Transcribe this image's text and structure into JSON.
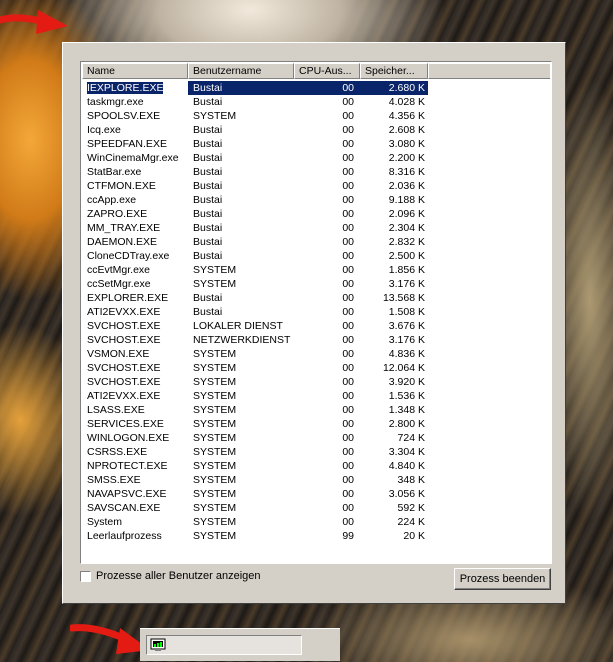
{
  "columns": {
    "name": "Name",
    "user": "Benutzername",
    "cpu": "CPU-Aus...",
    "mem": "Speicher..."
  },
  "processes": [
    {
      "name": "IEXPLORE.EXE",
      "user": "Bustai",
      "cpu": "00",
      "mem": "2.680 K"
    },
    {
      "name": "taskmgr.exe",
      "user": "Bustai",
      "cpu": "00",
      "mem": "4.028 K"
    },
    {
      "name": "SPOOLSV.EXE",
      "user": "SYSTEM",
      "cpu": "00",
      "mem": "4.356 K"
    },
    {
      "name": "Icq.exe",
      "user": "Bustai",
      "cpu": "00",
      "mem": "2.608 K"
    },
    {
      "name": "SPEEDFAN.EXE",
      "user": "Bustai",
      "cpu": "00",
      "mem": "3.080 K"
    },
    {
      "name": "WinCinemaMgr.exe",
      "user": "Bustai",
      "cpu": "00",
      "mem": "2.200 K"
    },
    {
      "name": "StatBar.exe",
      "user": "Bustai",
      "cpu": "00",
      "mem": "8.316 K"
    },
    {
      "name": "CTFMON.EXE",
      "user": "Bustai",
      "cpu": "00",
      "mem": "2.036 K"
    },
    {
      "name": "ccApp.exe",
      "user": "Bustai",
      "cpu": "00",
      "mem": "9.188 K"
    },
    {
      "name": "ZAPRO.EXE",
      "user": "Bustai",
      "cpu": "00",
      "mem": "2.096 K"
    },
    {
      "name": "MM_TRAY.EXE",
      "user": "Bustai",
      "cpu": "00",
      "mem": "2.304 K"
    },
    {
      "name": "DAEMON.EXE",
      "user": "Bustai",
      "cpu": "00",
      "mem": "2.832 K"
    },
    {
      "name": "CloneCDTray.exe",
      "user": "Bustai",
      "cpu": "00",
      "mem": "2.500 K"
    },
    {
      "name": "ccEvtMgr.exe",
      "user": "SYSTEM",
      "cpu": "00",
      "mem": "1.856 K"
    },
    {
      "name": "ccSetMgr.exe",
      "user": "SYSTEM",
      "cpu": "00",
      "mem": "3.176 K"
    },
    {
      "name": "EXPLORER.EXE",
      "user": "Bustai",
      "cpu": "00",
      "mem": "13.568 K"
    },
    {
      "name": "ATI2EVXX.EXE",
      "user": "Bustai",
      "cpu": "00",
      "mem": "1.508 K"
    },
    {
      "name": "SVCHOST.EXE",
      "user": "LOKALER DIENST",
      "cpu": "00",
      "mem": "3.676 K"
    },
    {
      "name": "SVCHOST.EXE",
      "user": "NETZWERKDIENST",
      "cpu": "00",
      "mem": "3.176 K"
    },
    {
      "name": "VSMON.EXE",
      "user": "SYSTEM",
      "cpu": "00",
      "mem": "4.836 K"
    },
    {
      "name": "SVCHOST.EXE",
      "user": "SYSTEM",
      "cpu": "00",
      "mem": "12.064 K"
    },
    {
      "name": "SVCHOST.EXE",
      "user": "SYSTEM",
      "cpu": "00",
      "mem": "3.920 K"
    },
    {
      "name": "ATI2EVXX.EXE",
      "user": "SYSTEM",
      "cpu": "00",
      "mem": "1.536 K"
    },
    {
      "name": "LSASS.EXE",
      "user": "SYSTEM",
      "cpu": "00",
      "mem": "1.348 K"
    },
    {
      "name": "SERVICES.EXE",
      "user": "SYSTEM",
      "cpu": "00",
      "mem": "2.800 K"
    },
    {
      "name": "WINLOGON.EXE",
      "user": "SYSTEM",
      "cpu": "00",
      "mem": "724 K"
    },
    {
      "name": "CSRSS.EXE",
      "user": "SYSTEM",
      "cpu": "00",
      "mem": "3.304 K"
    },
    {
      "name": "NPROTECT.EXE",
      "user": "SYSTEM",
      "cpu": "00",
      "mem": "4.840 K"
    },
    {
      "name": "SMSS.EXE",
      "user": "SYSTEM",
      "cpu": "00",
      "mem": "348 K"
    },
    {
      "name": "NAVAPSVC.EXE",
      "user": "SYSTEM",
      "cpu": "00",
      "mem": "3.056 K"
    },
    {
      "name": "SAVSCAN.EXE",
      "user": "SYSTEM",
      "cpu": "00",
      "mem": "592 K"
    },
    {
      "name": "System",
      "user": "SYSTEM",
      "cpu": "00",
      "mem": "224 K"
    },
    {
      "name": "Leerlaufprozess",
      "user": "SYSTEM",
      "cpu": "99",
      "mem": "20 K"
    }
  ],
  "selected_index": 0,
  "show_all_users_label": "Prozesse aller Benutzer anzeigen",
  "end_process_label": "Prozess beenden",
  "icons": {
    "taskbar": "task-manager-icon",
    "annotation": "red-arrow-icon"
  },
  "colors": {
    "selection": "#0a246a",
    "dialog": "#d4d0c8",
    "annotation": "#e41b12"
  }
}
